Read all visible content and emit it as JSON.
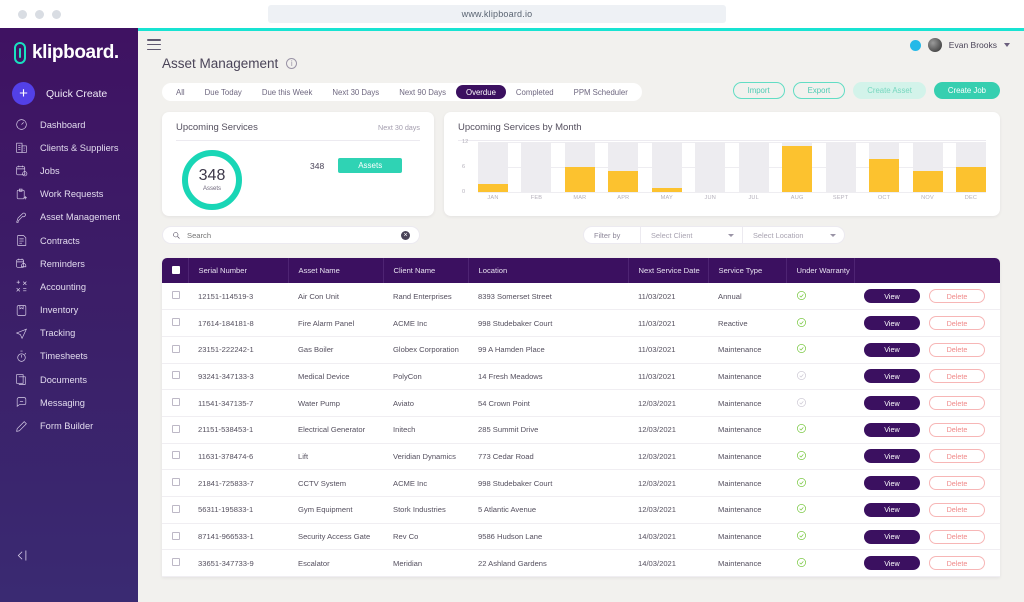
{
  "browser": {
    "url": "www.klipboard.io"
  },
  "sidebar": {
    "brand": "klipboard.",
    "quick_create": "Quick Create",
    "collapse_label": "collapse-sidebar",
    "items": [
      {
        "label": "Dashboard",
        "icon": "gauge-icon"
      },
      {
        "label": "Clients & Suppliers",
        "icon": "building-icon"
      },
      {
        "label": "Jobs",
        "icon": "calendar-clock-icon"
      },
      {
        "label": "Work Requests",
        "icon": "clipboard-plus-icon"
      },
      {
        "label": "Asset Management",
        "icon": "wrench-icon"
      },
      {
        "label": "Contracts",
        "icon": "contract-icon"
      },
      {
        "label": "Reminders",
        "icon": "bell-calendar-icon"
      },
      {
        "label": "Accounting",
        "icon": "calculator-icon"
      },
      {
        "label": "Inventory",
        "icon": "box-icon"
      },
      {
        "label": "Tracking",
        "icon": "paper-plane-icon"
      },
      {
        "label": "Timesheets",
        "icon": "stopwatch-icon"
      },
      {
        "label": "Documents",
        "icon": "documents-icon"
      },
      {
        "label": "Messaging",
        "icon": "chat-icon"
      },
      {
        "label": "Form Builder",
        "icon": "pencil-icon"
      }
    ]
  },
  "topbar": {
    "user_name": "Evan Brooks"
  },
  "header": {
    "title": "Asset Management",
    "tabs": [
      {
        "label": "All",
        "active": false
      },
      {
        "label": "Due Today",
        "active": false
      },
      {
        "label": "Due this Week",
        "active": false
      },
      {
        "label": "Next 30 Days",
        "active": false
      },
      {
        "label": "Next 90 Days",
        "active": false
      },
      {
        "label": "Overdue",
        "active": true
      },
      {
        "label": "Completed",
        "active": false
      },
      {
        "label": "PPM Scheduler",
        "active": false
      }
    ],
    "actions": [
      {
        "label": "Import",
        "style": "outline"
      },
      {
        "label": "Export",
        "style": "outline"
      },
      {
        "label": "Create Asset",
        "style": "soft"
      },
      {
        "label": "Create Job",
        "style": "solid"
      }
    ]
  },
  "upcoming_card": {
    "title": "Upcoming Services",
    "subtitle": "Next 30 days",
    "donut_value": "348",
    "donut_label": "Assets",
    "legend_value": "348",
    "legend_label": "Assets"
  },
  "chart_data": {
    "type": "bar",
    "title": "Upcoming Services by Month",
    "categories": [
      "JAN",
      "FEB",
      "MAR",
      "APR",
      "MAY",
      "JUN",
      "JUL",
      "AUG",
      "SEPT",
      "OCT",
      "NOV",
      "DEC"
    ],
    "values": [
      2,
      0,
      6,
      5,
      1,
      0,
      0,
      11,
      0,
      8,
      5,
      6
    ],
    "xlabel": "",
    "ylabel": "",
    "ylim": [
      0,
      12
    ],
    "yticks": [
      "0",
      "6",
      "12"
    ],
    "grid": true,
    "legend": "none",
    "bar_color": "#fcc22f",
    "track_color": "#edecf0"
  },
  "search": {
    "placeholder": "Search",
    "value": ""
  },
  "filters": {
    "label": "Filter by",
    "client_placeholder": "Select Client",
    "location_placeholder": "Select Location"
  },
  "table": {
    "columns": [
      "",
      "Serial Number",
      "Asset Name",
      "Client Name",
      "Location",
      "Next Service Date",
      "Service Type",
      "Under Warranty",
      ""
    ],
    "view_label": "View",
    "delete_label": "Delete",
    "rows": [
      {
        "serial": "12151-114519-3",
        "asset": "Air Con Unit",
        "client": "Rand Enterprises",
        "location": "8393 Somerset Street",
        "date": "11/03/2021",
        "service": "Annual",
        "warranty": true
      },
      {
        "serial": "17614-184181-8",
        "asset": "Fire Alarm Panel",
        "client": "ACME Inc",
        "location": "998 Studebaker Court",
        "date": "11/03/2021",
        "service": "Reactive",
        "warranty": true
      },
      {
        "serial": "23151-222242-1",
        "asset": "Gas Boiler",
        "client": "Globex Corporation",
        "location": "99 A Hamden Place",
        "date": "11/03/2021",
        "service": "Maintenance",
        "warranty": true
      },
      {
        "serial": "93241-347133-3",
        "asset": "Medical Device",
        "client": "PolyCon",
        "location": "14 Fresh Meadows",
        "date": "11/03/2021",
        "service": "Maintenance",
        "warranty": false
      },
      {
        "serial": "11541-347135-7",
        "asset": "Water Pump",
        "client": "Aviato",
        "location": "54 Crown Point",
        "date": "12/03/2021",
        "service": "Maintenance",
        "warranty": false
      },
      {
        "serial": "21151-538453-1",
        "asset": "Electrical Generator",
        "client": "Initech",
        "location": "285 Summit Drive",
        "date": "12/03/2021",
        "service": "Maintenance",
        "warranty": true
      },
      {
        "serial": "11631-378474-6",
        "asset": "Lift",
        "client": "Veridian Dynamics",
        "location": "773 Cedar Road",
        "date": "12/03/2021",
        "service": "Maintenance",
        "warranty": true
      },
      {
        "serial": "21841-725833-7",
        "asset": "CCTV System",
        "client": "ACME Inc",
        "location": "998 Studebaker Court",
        "date": "12/03/2021",
        "service": "Maintenance",
        "warranty": true
      },
      {
        "serial": "56311-195833-1",
        "asset": "Gym Equipment",
        "client": "Stork Industries",
        "location": "5 Atlantic Avenue",
        "date": "12/03/2021",
        "service": "Maintenance",
        "warranty": true
      },
      {
        "serial": "87141-966533-1",
        "asset": "Security Access Gate",
        "client": "Rev Co",
        "location": "9586 Hudson Lane",
        "date": "14/03/2021",
        "service": "Maintenance",
        "warranty": true
      },
      {
        "serial": "33651-347733-9",
        "asset": "Escalator",
        "client": "Meridian",
        "location": "22 Ashland Gardens",
        "date": "14/03/2021",
        "service": "Maintenance",
        "warranty": true
      }
    ]
  },
  "colors": {
    "sidebar": "#3b1d63",
    "accent_teal": "#18e3d2",
    "primary_purple": "#3b1060",
    "bar_yellow": "#fcc22f",
    "warranty_green": "#7ac943",
    "delete_red": "#f08a8a"
  }
}
